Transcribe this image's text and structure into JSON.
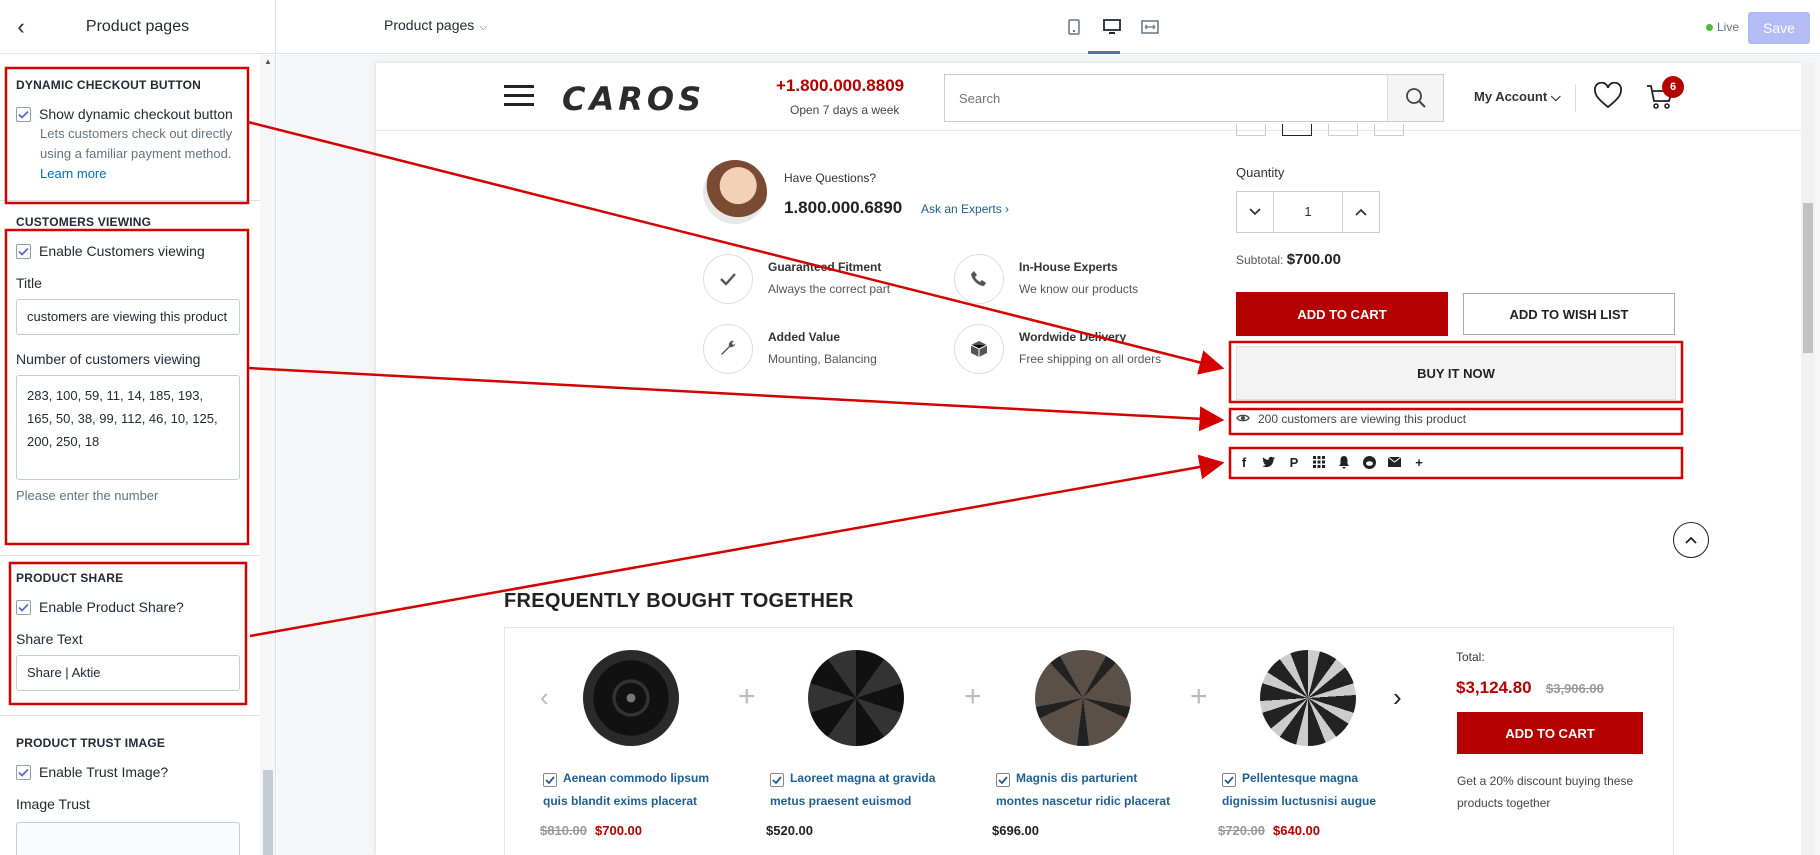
{
  "editor": {
    "sidebar_title": "Product pages",
    "page_select": "Product pages",
    "live_label": "Live",
    "save_label": "Save"
  },
  "sidebar": {
    "dynamic_checkout": {
      "title": "DYNAMIC CHECKOUT BUTTON",
      "checkbox_label": "Show dynamic checkout button",
      "help": "Lets customers check out directly using a familiar payment method.",
      "learn_more": "Learn more"
    },
    "customers_viewing": {
      "title": "CUSTOMERS VIEWING",
      "checkbox_label": "Enable Customers viewing",
      "title_label": "Title",
      "title_value": "customers are viewing this product",
      "number_label": "Number of customers viewing",
      "number_value": "283, 100, 59, 11, 14, 185, 193, 165, 50, 38, 99, 112, 46, 10, 125, 200, 250, 18",
      "note": "Please enter the number"
    },
    "product_share": {
      "title": "PRODUCT SHARE",
      "checkbox_label": "Enable Product Share?",
      "share_text_label": "Share Text",
      "share_text_value": "Share | Aktie"
    },
    "trust_image": {
      "title": "PRODUCT TRUST IMAGE",
      "checkbox_label": "Enable Trust Image?",
      "image_label": "Image Trust"
    }
  },
  "store": {
    "logo": "CAROS",
    "phone": "+1.800.000.8809",
    "hours": "Open 7 days a week",
    "search_placeholder": "Search",
    "account": "My Account",
    "cart_count": "6",
    "questions_label": "Have Questions?",
    "questions_phone": "1.800.000.6890",
    "ask_link": "Ask an Experts",
    "features": [
      {
        "title": "Guaranteed Fitment",
        "sub": "Always the correct part"
      },
      {
        "title": "In-House Experts",
        "sub": "We know our products"
      },
      {
        "title": "Added Value",
        "sub": "Mounting, Balancing"
      },
      {
        "title": "Wordwide Delivery",
        "sub": "Free shipping on all orders"
      }
    ],
    "quantity_label": "Quantity",
    "quantity_value": "1",
    "subtotal_label": "Subtotal:",
    "subtotal_value": "$700.00",
    "add_to_cart": "ADD TO CART",
    "add_to_wish": "ADD TO WISH LIST",
    "buy_now": "BUY IT NOW",
    "viewing_text": "200 customers are viewing this product",
    "fbt_title": "FREQUENTLY BOUGHT TOGETHER",
    "products": [
      {
        "name1": "Aenean commodo lipsum",
        "name2": "quis blandit exims placerat",
        "old": "$810.00",
        "price": "$700.00"
      },
      {
        "name1": "Laoreet magna at gravida",
        "name2": "metus praesent euismod",
        "old": "",
        "price": "$520.00"
      },
      {
        "name1": "Magnis dis parturient",
        "name2": "montes nascetur ridic placerat",
        "old": "",
        "price": "$696.00"
      },
      {
        "name1": "Pellentesque magna",
        "name2": "dignissim luctusnisi augue",
        "old": "$720.00",
        "price": "$640.00"
      }
    ],
    "total_label": "Total:",
    "total_value": "$3,124.80",
    "total_old": "$3,906.00",
    "fbt_add_to_cart": "ADD TO CART",
    "fbt_note": "Get a 20% discount buying these products together"
  },
  "colors": {
    "accent_red": "#b40000",
    "annotation_red": "#d40000",
    "link_blue": "#1f5e93",
    "admin_primary": "#5c6ac4"
  }
}
